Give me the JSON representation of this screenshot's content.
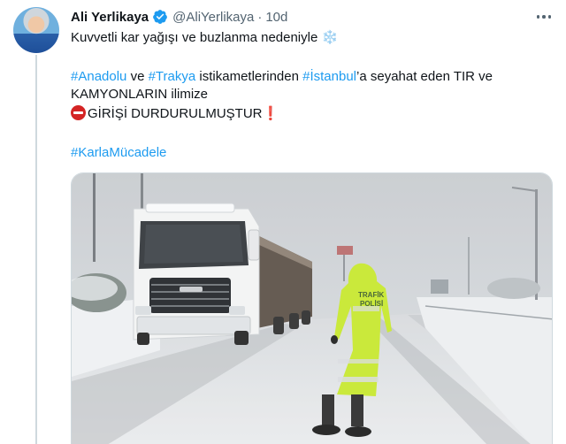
{
  "tweet": {
    "author_name": "Ali Yerlikaya",
    "handle": "@AliYerlikaya",
    "separator": "·",
    "time": "10d",
    "line1": "Kuvvetli kar yağışı ve buzlanma nedeniyle",
    "line1_emoji": "❄️",
    "hashtag_anadolu": "#Anadolu",
    "word_ve": " ve ",
    "hashtag_trakya": "#Trakya",
    "word_istikamet": " istikametlerinden ",
    "hashtag_istanbul": "#İstanbul",
    "line2_rest": "’a seyahat eden TIR ve",
    "line3": "KAMYONLARIN ilimize",
    "line4": "GİRİŞİ DURDURULMUŞTUR",
    "line4_emoji": "❗",
    "hashtag_karla": "#KarlaMücadele"
  },
  "media": {
    "vest_text_line1": "TRAFİK",
    "vest_text_line2": "POLİSİ"
  },
  "icons": {
    "verified": "verified-badge-icon",
    "more": "more-options-icon",
    "no_entry": "no-entry-icon"
  },
  "colors": {
    "link": "#1d9bf0",
    "secondary_text": "#536471",
    "verified": "#1d9bf0",
    "vest": "#c6e82b"
  }
}
